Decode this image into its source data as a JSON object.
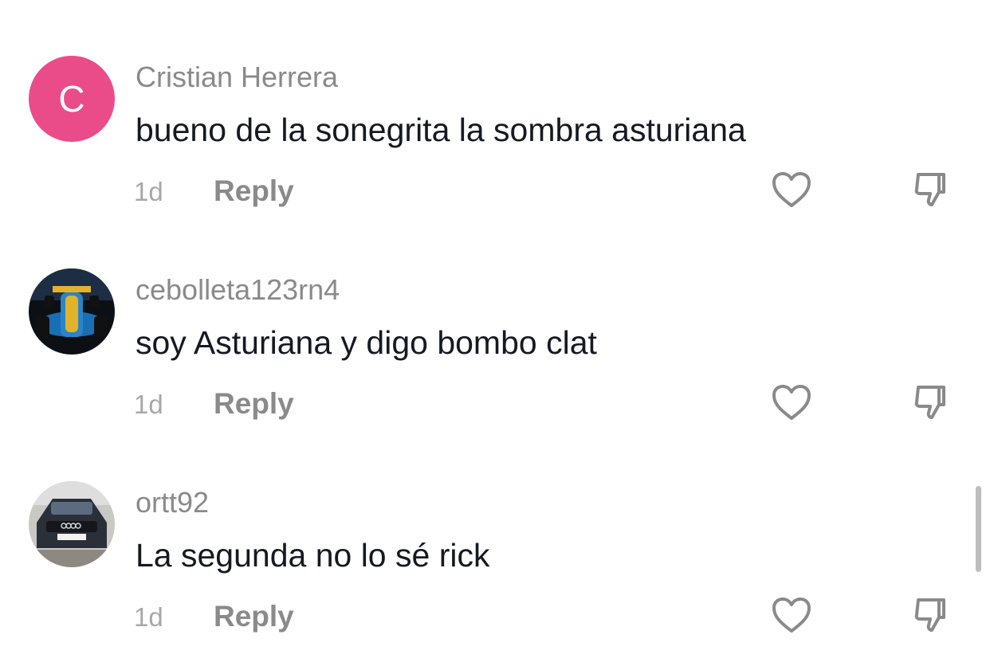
{
  "comments": [
    {
      "username": "Cristian Herrera",
      "avatar_letter": "C",
      "text": "bueno de la sonegrita la sombra asturiana",
      "time": "1d",
      "reply_label": "Reply"
    },
    {
      "username": "cebolleta123rn4",
      "text": "soy Asturiana y digo bombo clat",
      "time": "1d",
      "reply_label": "Reply"
    },
    {
      "username": "ortt92",
      "text": "La segunda no lo sé rick",
      "time": "1d",
      "reply_label": "Reply"
    }
  ],
  "icons": {
    "like": "heart-outline-icon",
    "dislike": "thumbs-down-outline-icon"
  },
  "colors": {
    "avatar_c": "#ea4c89",
    "username": "#8a8a8a",
    "text": "#161823",
    "meta": "#a8a8a8"
  }
}
